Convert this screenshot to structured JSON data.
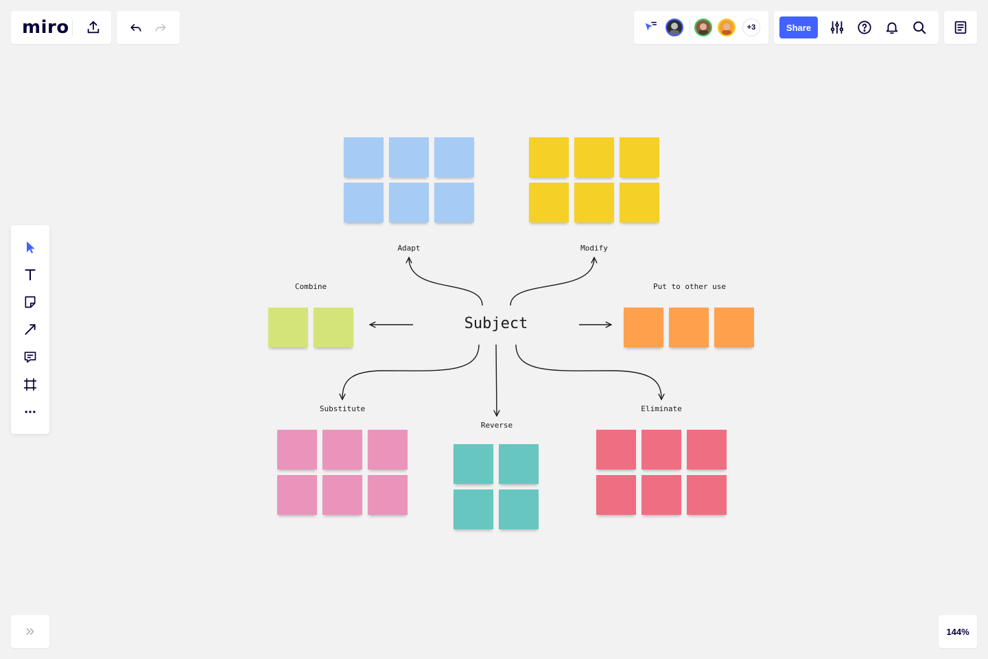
{
  "app": {
    "logo": "miro"
  },
  "collaborators": {
    "more_count": "+3"
  },
  "header": {
    "share_label": "Share"
  },
  "zoom": {
    "level": "144%"
  },
  "board": {
    "center": "Subject",
    "branches": [
      {
        "label": "Adapt",
        "color": "#a6ccf5"
      },
      {
        "label": "Modify",
        "color": "#f5d128"
      },
      {
        "label": "Combine",
        "color": "#d5e479"
      },
      {
        "label": "Put to other use",
        "color": "#ffa04d"
      },
      {
        "label": "Substitute",
        "color": "#ea94bb"
      },
      {
        "label": "Reverse",
        "color": "#67c6c0"
      },
      {
        "label": "Eliminate",
        "color": "#f06e82"
      }
    ]
  },
  "colors": {
    "accent": "#4262ff",
    "ink": "#050038",
    "canvas": "#f2f2f2"
  },
  "icons": {
    "header": [
      "export-icon",
      "undo-icon",
      "redo-icon",
      "cursor-follow-icon",
      "settings-sliders-icon",
      "help-icon",
      "bell-icon",
      "search-icon",
      "notes-icon"
    ],
    "toolbar": [
      "select-icon",
      "text-icon",
      "sticky-note-icon",
      "line-icon",
      "comment-icon",
      "frame-icon",
      "more-icon"
    ],
    "footer": [
      "expand-icon"
    ]
  }
}
